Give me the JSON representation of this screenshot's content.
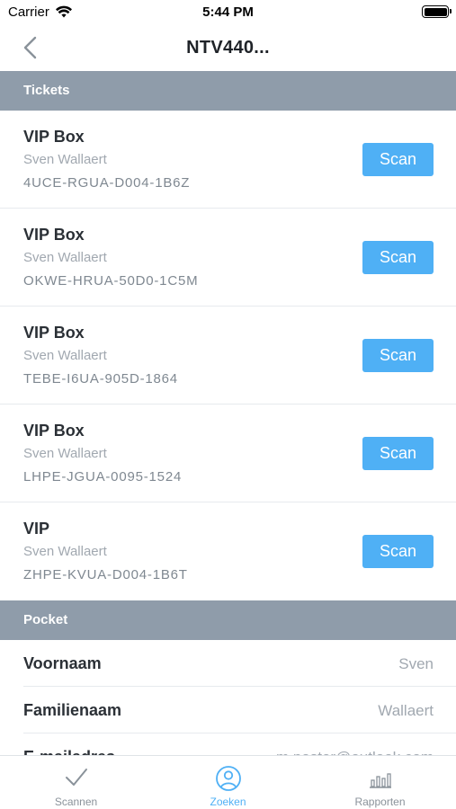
{
  "status": {
    "carrier": "Carrier",
    "time": "5:44 PM"
  },
  "nav": {
    "title": "NTV440..."
  },
  "sections": {
    "tickets": "Tickets",
    "pocket": "Pocket"
  },
  "tickets": [
    {
      "type": "VIP Box",
      "holder": "Sven Wallaert",
      "code": "4UCE-RGUA-D004-1B6Z",
      "action": "Scan"
    },
    {
      "type": "VIP Box",
      "holder": "Sven Wallaert",
      "code": "OKWE-HRUA-50D0-1C5M",
      "action": "Scan"
    },
    {
      "type": "VIP Box",
      "holder": "Sven Wallaert",
      "code": "TEBE-I6UA-905D-1864",
      "action": "Scan"
    },
    {
      "type": "VIP Box",
      "holder": "Sven Wallaert",
      "code": "LHPE-JGUA-0095-1524",
      "action": "Scan"
    },
    {
      "type": "VIP",
      "holder": "Sven Wallaert",
      "code": "ZHPE-KVUA-D004-1B6T",
      "action": "Scan"
    }
  ],
  "pocket": [
    {
      "label": "Voornaam",
      "value": "Sven"
    },
    {
      "label": "Familienaam",
      "value": "Wallaert"
    },
    {
      "label": "E-mailadres",
      "value": "m.poster@outlook.com"
    }
  ],
  "tabs": [
    {
      "label": "Scannen",
      "icon": "checkmark-icon",
      "active": false
    },
    {
      "label": "Zoeken",
      "icon": "user-search-icon",
      "active": true
    },
    {
      "label": "Rapporten",
      "icon": "bar-chart-icon",
      "active": false
    }
  ],
  "colors": {
    "accent": "#4fb0f5",
    "section_header": "#8f9caa"
  }
}
